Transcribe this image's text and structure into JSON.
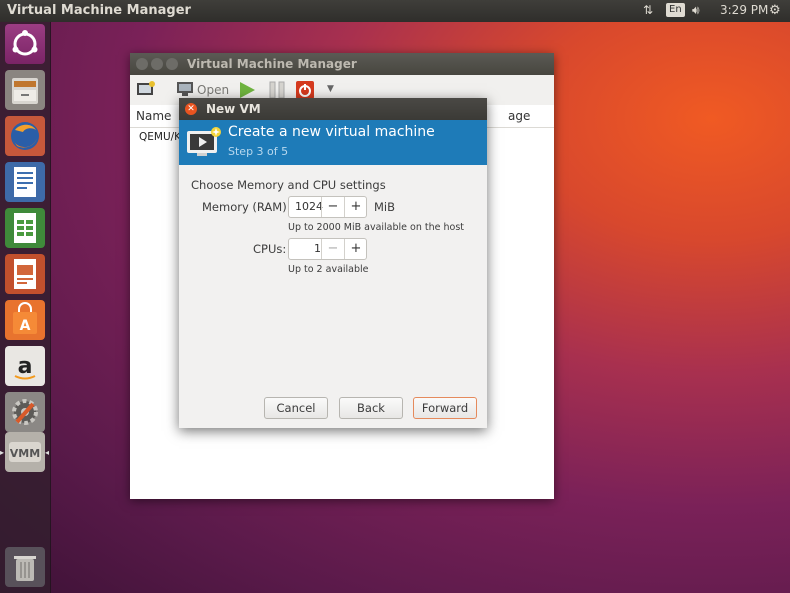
{
  "topbar": {
    "app_title": "Virtual Machine Manager",
    "keyboard": "En",
    "clock": "3:29 PM"
  },
  "launcher": {
    "items": [
      "ubuntu-dash",
      "files",
      "firefox",
      "libreoffice-writer",
      "libreoffice-calc",
      "libreoffice-impress",
      "ubuntu-software",
      "amazon",
      "system-settings",
      "virt-manager",
      "trash"
    ]
  },
  "main_window": {
    "title": "Virtual Machine Manager",
    "toolbar_open": "Open",
    "col_name": "Name",
    "col_usage": "age",
    "row_conn": "QEMU/KV"
  },
  "dialog": {
    "title": "New VM",
    "heading": "Create a new virtual machine",
    "step": "Step 3 of 5",
    "section": "Choose Memory and CPU settings",
    "memory_label": "Memory (RAM):",
    "memory_value": "1024",
    "memory_unit": "MiB",
    "memory_hint": "Up to 2000 MiB available on the host",
    "cpus_label": "CPUs:",
    "cpus_value": "1",
    "cpus_hint": "Up to 2 available",
    "minus": "−",
    "plus": "+",
    "cancel": "Cancel",
    "back": "Back",
    "forward": "Forward"
  },
  "colors": {
    "banner": "#1e7bb8",
    "close_button": "#e95420",
    "forward_border": "#e58a5c"
  }
}
